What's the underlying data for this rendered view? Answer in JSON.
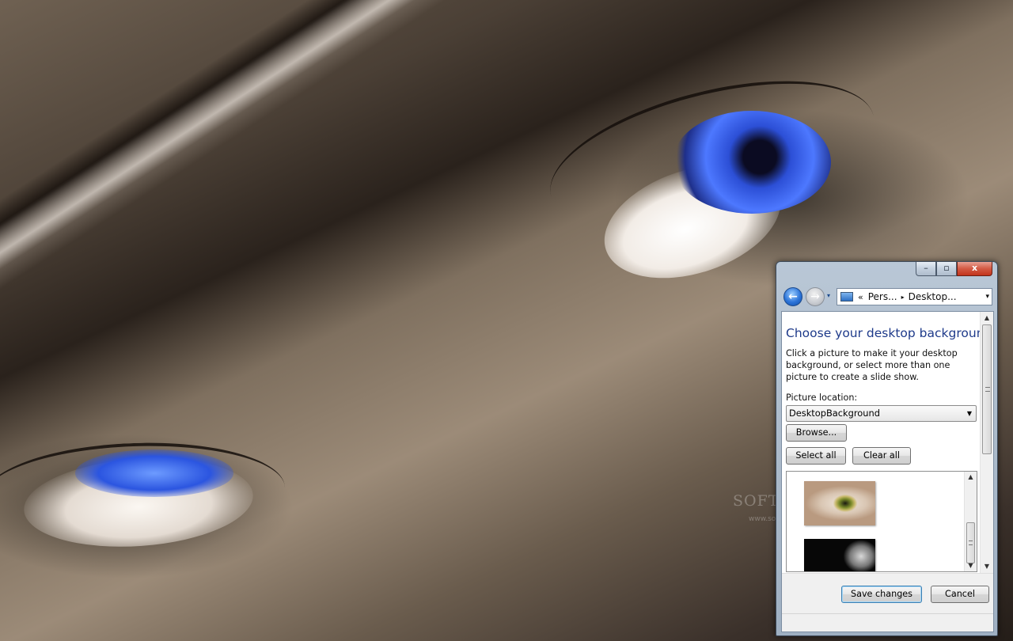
{
  "desktop": {
    "watermark": "SOFTPEDIA",
    "watermark_url": "www.softpedia.com"
  },
  "window": {
    "caption": {
      "minimize_glyph": "–",
      "maximize_glyph": "▫",
      "close_glyph": "x"
    },
    "nav": {
      "back_glyph": "←",
      "forward_glyph": "→",
      "dropdown_glyph": "▾"
    },
    "address": {
      "overflow": "«",
      "crumbs": [
        "Pers...",
        "Desktop..."
      ],
      "separator": "▸",
      "dropdown_glyph": "▾"
    },
    "page": {
      "title": "Choose your desktop background",
      "description": "Click a picture to make it your desktop background, or select more than one picture to create a slide show.",
      "picture_location_label": "Picture location:",
      "picture_location_value": "DesktopBackground",
      "browse_label": "Browse...",
      "select_all_label": "Select all",
      "clear_all_label": "Clear all"
    },
    "thumbnails": [
      {
        "name": "green-eye"
      },
      {
        "name": "dark-face"
      }
    ],
    "footer": {
      "save_label": "Save changes",
      "cancel_label": "Cancel"
    }
  },
  "colors": {
    "title_blue": "#1e3a8a",
    "close_red": "#c2331c"
  }
}
